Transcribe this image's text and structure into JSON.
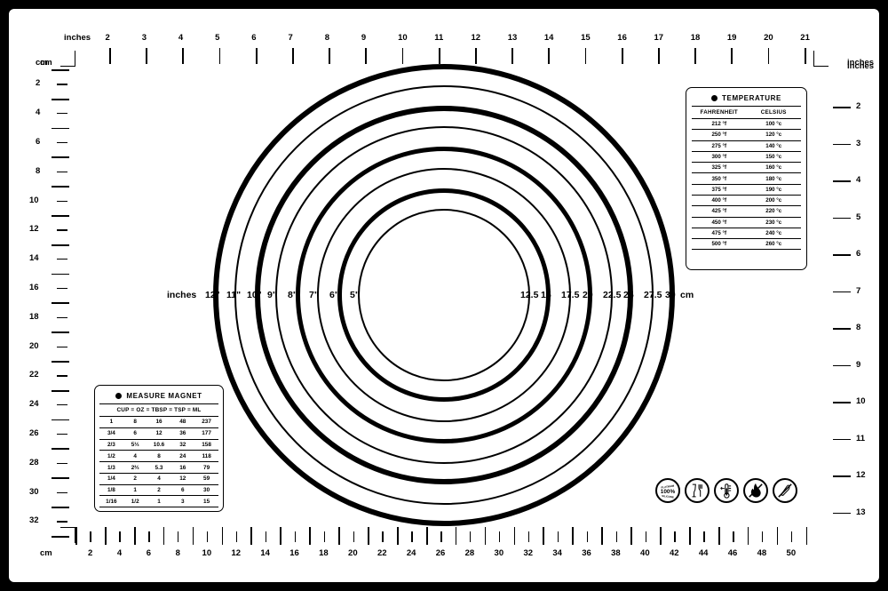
{
  "product": {
    "name": "silicone-pastry-mat",
    "border_color": "#000000",
    "surface_color": "#ffffff",
    "ink_color": "#000000"
  },
  "rulers": {
    "top": {
      "unit_label_left": "inches",
      "unit_label_right": "inches",
      "corner_label_left": "cm",
      "labels": [
        "2",
        "3",
        "4",
        "5",
        "6",
        "7",
        "8",
        "9",
        "10",
        "11",
        "12",
        "13",
        "14",
        "15",
        "16",
        "17",
        "18",
        "19",
        "20",
        "21"
      ]
    },
    "bottom": {
      "unit_label_left": "cm",
      "labels": [
        "2",
        "4",
        "6",
        "8",
        "10",
        "12",
        "14",
        "16",
        "18",
        "20",
        "22",
        "24",
        "26",
        "28",
        "30",
        "32",
        "34",
        "36",
        "38",
        "40",
        "42",
        "44",
        "46",
        "48",
        "50"
      ]
    },
    "left": {
      "unit_label": "cm",
      "labels": [
        "2",
        "4",
        "6",
        "8",
        "10",
        "12",
        "14",
        "16",
        "18",
        "20",
        "22",
        "24",
        "26",
        "28",
        "30",
        "32"
      ]
    },
    "right": {
      "unit_label": "inches",
      "labels": [
        "2",
        "3",
        "4",
        "5",
        "6",
        "7",
        "8",
        "9",
        "10",
        "11",
        "12",
        "13"
      ]
    }
  },
  "circles": {
    "left_unit_label": "inches",
    "right_unit_label": "cm",
    "inch_labels": [
      "12\"",
      "11\"",
      "10\"",
      "9\"",
      "8\"",
      "7\"",
      "6\"",
      "5\""
    ],
    "cm_labels": [
      "12.5",
      "15",
      "17.5",
      "20",
      "22.5",
      "25",
      "27.5",
      "30"
    ],
    "rings": [
      {
        "inches": "12\"",
        "cm": "30",
        "radius_px": 260,
        "stroke": 6.5
      },
      {
        "inches": "11\"",
        "cm": "27.5",
        "radius_px": 236,
        "stroke": 2.6
      },
      {
        "inches": "10\"",
        "cm": "25",
        "radius_px": 213,
        "stroke": 6.0
      },
      {
        "inches": "9\"",
        "cm": "22.5",
        "radius_px": 190,
        "stroke": 2.4
      },
      {
        "inches": "8\"",
        "cm": "20",
        "radius_px": 167,
        "stroke": 5.5
      },
      {
        "inches": "7\"",
        "cm": "17.5",
        "radius_px": 143,
        "stroke": 2.2
      },
      {
        "inches": "6\"",
        "cm": "15",
        "radius_px": 120,
        "stroke": 5.0
      },
      {
        "inches": "5\"",
        "cm": "12.5",
        "radius_px": 97,
        "stroke": 2.0
      }
    ]
  },
  "temperature_card": {
    "title": "TEMPERATURE",
    "columns": [
      "FAHRENHEIT",
      "CELSIUS"
    ],
    "rows": [
      [
        "212 °f",
        "100 °c"
      ],
      [
        "250 °f",
        "120 °c"
      ],
      [
        "275 °f",
        "140 °c"
      ],
      [
        "300 °f",
        "150 °c"
      ],
      [
        "325 °f",
        "160 °c"
      ],
      [
        "350 °f",
        "180 °c"
      ],
      [
        "375 °f",
        "190 °c"
      ],
      [
        "400 °f",
        "200 °c"
      ],
      [
        "425 °f",
        "220 °c"
      ],
      [
        "450 °f",
        "230 °c"
      ],
      [
        "475 °f",
        "240 °c"
      ],
      [
        "500 °f",
        "260 °c"
      ]
    ]
  },
  "measure_card": {
    "title": "MEASURE MAGNET",
    "columns": [
      "CUP",
      "=",
      "OZ",
      "=",
      "TBSP",
      "=",
      "TSP",
      "=",
      "ML"
    ],
    "header_text": "CUP = OZ = TBSP = TSP = ML",
    "rows": [
      [
        "1",
        "8",
        "16",
        "48",
        "237"
      ],
      [
        "3/4",
        "6",
        "12",
        "36",
        "177"
      ],
      [
        "2/3",
        "5⅓",
        "10.6",
        "32",
        "158"
      ],
      [
        "1/2",
        "4",
        "8",
        "24",
        "118"
      ],
      [
        "1/3",
        "2⅔",
        "5.3",
        "16",
        "79"
      ],
      [
        "1/4",
        "2",
        "4",
        "12",
        "59"
      ],
      [
        "1/8",
        "1",
        "2",
        "6",
        "30"
      ],
      [
        "1/16",
        "1/2",
        "1",
        "3",
        "15"
      ]
    ]
  },
  "badges": [
    {
      "name": "platinum-silicone-icon",
      "top_text": "PLATINUM",
      "main_text": "100%",
      "bottom_text": "SILICONE"
    },
    {
      "name": "food-safe-icon",
      "label": "glass-and-fork"
    },
    {
      "name": "temperature-range-icon",
      "label": "thermometer"
    },
    {
      "name": "no-open-flame-icon",
      "label": "flame-crossed"
    },
    {
      "name": "no-knife-icon",
      "label": "knife-crossed"
    }
  ]
}
